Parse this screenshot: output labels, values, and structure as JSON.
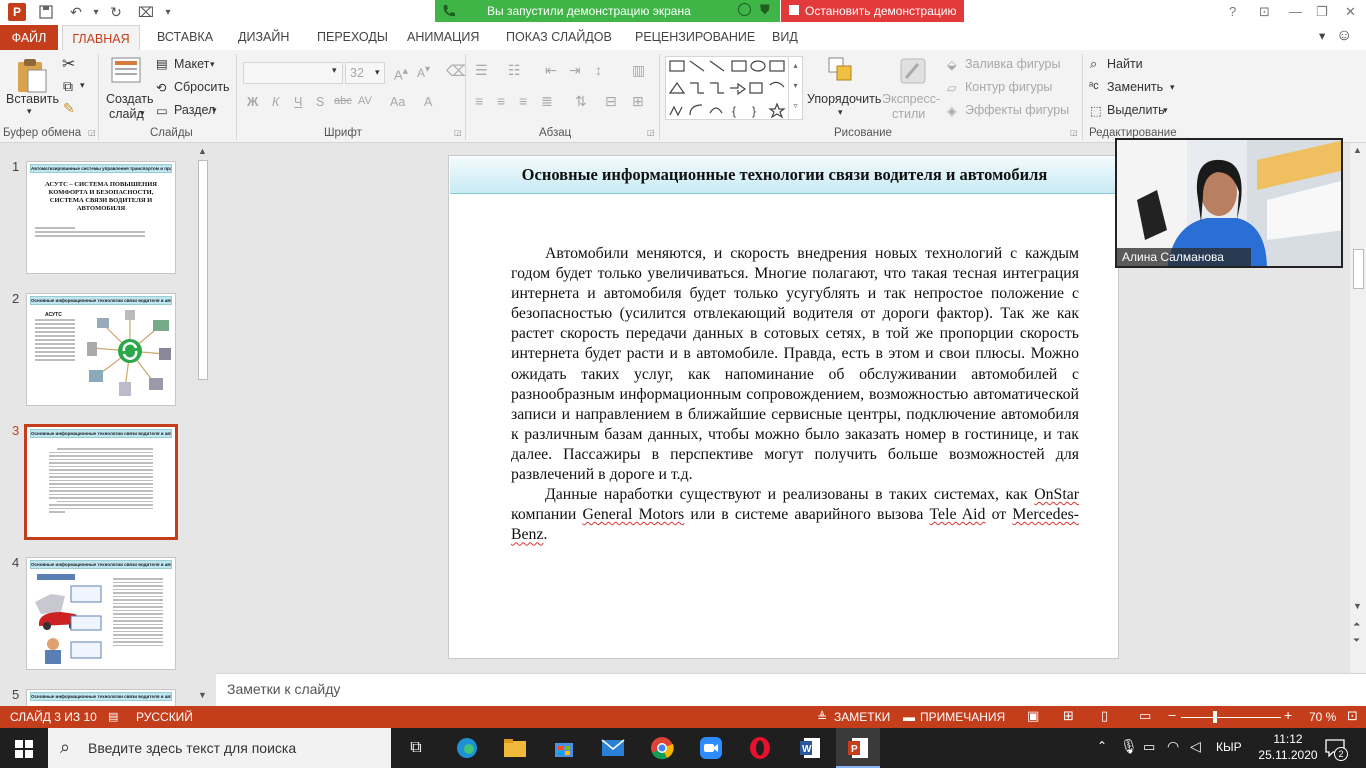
{
  "window": {
    "app_logo": "P",
    "share_banner": "Вы запустили демонстрацию экрана",
    "stop_demo": "Остановить демонстрацию"
  },
  "tabs": {
    "file": "ФАЙЛ",
    "home": "ГЛАВНАЯ",
    "insert": "ВСТАВКА",
    "design": "ДИЗАЙН",
    "transitions": "ПЕРЕХОДЫ",
    "animation": "АНИМАЦИЯ",
    "slideshow": "ПОКАЗ СЛАЙДОВ",
    "review": "РЕЦЕНЗИРОВАНИЕ",
    "view": "ВИД"
  },
  "ribbon": {
    "paste": "Вставить",
    "clipboard": "Буфер обмена",
    "new_slide_1": "Создать",
    "new_slide_2": "слайд",
    "layout": "Макет",
    "reset": "Сбросить",
    "section": "Раздел",
    "slides": "Слайды",
    "font_size": "32",
    "bold": "Ж",
    "italic": "К",
    "underline": "Ч",
    "strike": "S",
    "font": "Шрифт",
    "paragraph": "Абзац",
    "arrange": "Упорядочить",
    "quick_styles_1": "Экспресс-",
    "quick_styles_2": "стили",
    "shape_fill": "Заливка фигуры",
    "shape_outline": "Контур фигуры",
    "shape_effects": "Эффекты фигуры",
    "drawing": "Рисование",
    "find": "Найти",
    "replace": "Заменить",
    "select": "Выделить",
    "editing": "Редактирование"
  },
  "thumbnails": [
    {
      "num": "1",
      "head": "Автоматизированные системы управления транспортом и практикума",
      "title": "АСУТС – СИСТЕМА ПОВЫШЕНИЯ КОМФОРТА И БЕЗОПАСНОСТИ, СИСТЕМА СВЯЗИ ВОДИТЕЛЯ И АВТОМОБИЛЯ"
    },
    {
      "num": "2",
      "head": "Основные информационные технологии связи водителя и автомобиля",
      "title": "АСУТС"
    },
    {
      "num": "3",
      "head": "Основные информационные технологии связи водителя и автомобиля",
      "title": ""
    },
    {
      "num": "4",
      "head": "Основные информационные технологии связи водителя и автомобиля",
      "title": ""
    },
    {
      "num": "5",
      "head": "Основные информационные технологии связи водителя и автомобиля",
      "title": ""
    }
  ],
  "slide": {
    "title": "Основные информационные технологии связи водителя и автомобиля",
    "p1": "Автомобили меняются, и скорость внедрения новых технологий с каждым годом будет только увеличиваться. Многие полагают, что такая тесная интеграция интернета и автомобиля будет только усугублять и так непростое положение с безопасностью (усилится отвлекающий водителя от дороги фактор). Так же как растет скорость передачи данных в сотовых сетях, в той же пропорции скорость интернета будет расти и в автомобиле. Правда, есть в этом и свои плюсы. Можно ожидать таких услуг, как напоминание об обслуживании автомобилей с разнообразным информационным сопровождением, возможностью автоматической записи и направлением в ближайшие сервисные центры, подключение автомобиля к различным базам данных, чтобы можно было заказать номер в гостинице, и так далее. Пассажиры в перспективе могут получить больше возможностей для развлечений в дороге и т.д.",
    "p2_a": "Данные наработки существуют и реализованы в таких системах, как ",
    "p2_onstar": "OnStar",
    "p2_b": " компании ",
    "p2_gm": "General Motors",
    "p2_c": " или в системе аварийного вызова ",
    "p2_tele": "Tele Aid",
    "p2_d": " от ",
    "p2_mb": "Mercedes-Benz",
    "p2_e": "."
  },
  "webcam": {
    "name": "Алина Салманова"
  },
  "notes": {
    "placeholder": "Заметки к слайду"
  },
  "status": {
    "slide_of": "СЛАЙД 3 ИЗ 10",
    "language": "РУССКИЙ",
    "notes": "ЗАМЕТКИ",
    "comments": "ПРИМЕЧАНИЯ",
    "zoom": "70 %"
  },
  "taskbar": {
    "search": "Введите здесь текст для поиска",
    "lang": "КЫР",
    "time": "11:12",
    "date": "25.11.2020",
    "notif_count": "2"
  },
  "colors": {
    "accent": "#c43e1c",
    "banner_green": "#3fb548",
    "stop_red": "#e23a3a"
  }
}
